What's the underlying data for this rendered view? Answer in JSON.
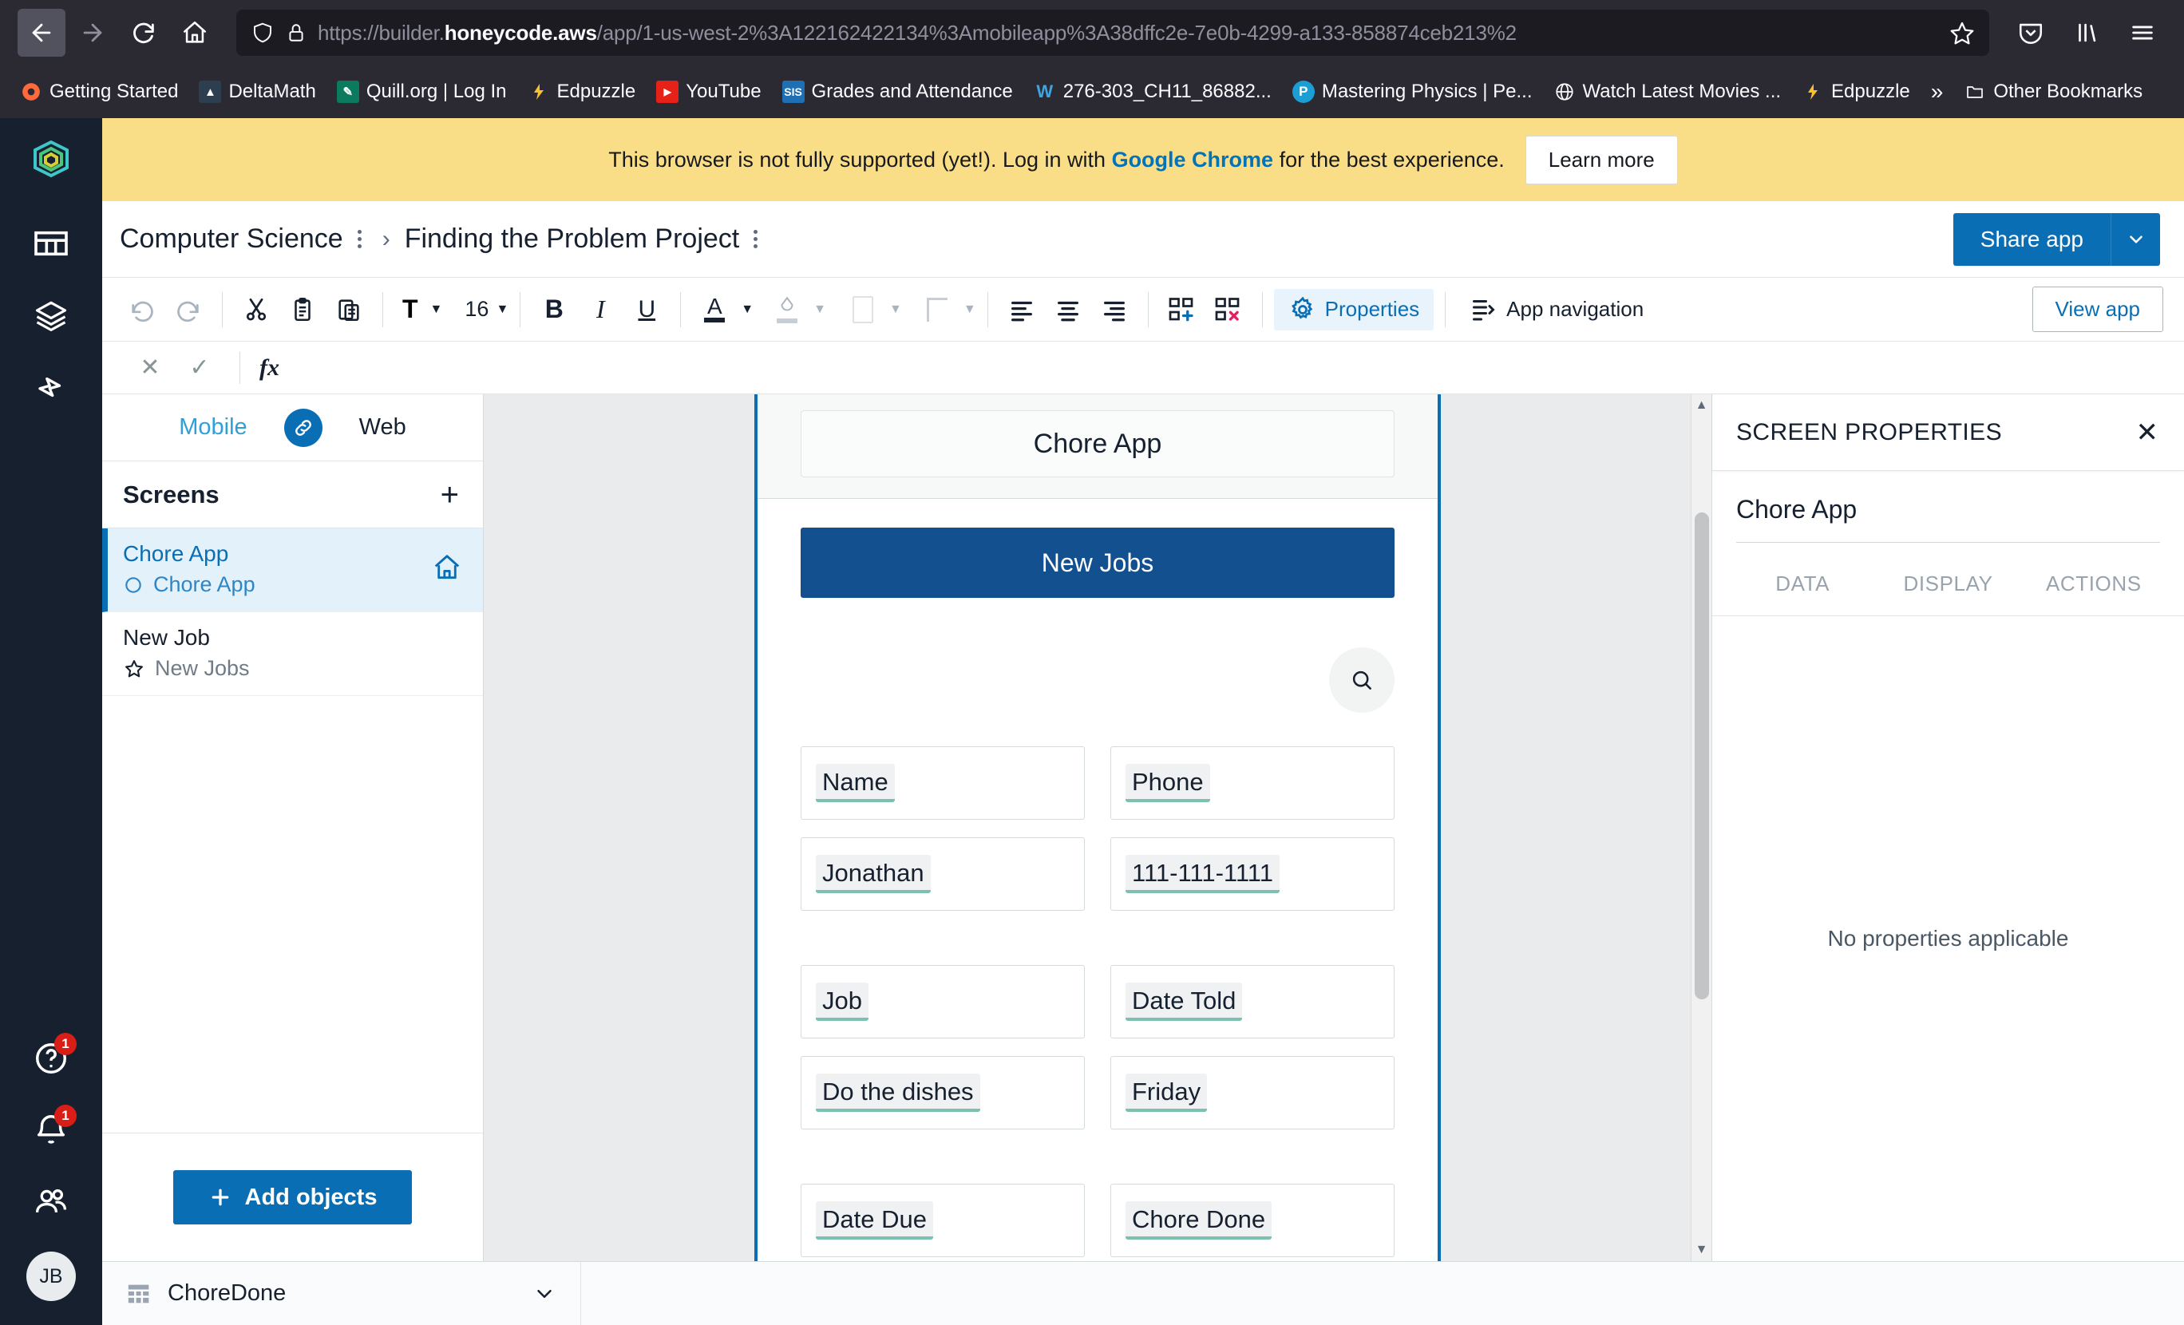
{
  "browser": {
    "url_prefix": "https://builder.",
    "url_bold": "honeycode.aws",
    "url_suffix": "/app/1-us-west-2%3A122162422134%3Amobileapp%3A38dffc2e-7e0b-4299-a133-858874ceb213%2",
    "nav": {
      "back": "back-arrow",
      "forward": "forward-arrow",
      "reload": "reload",
      "home": "home"
    },
    "bookmarks": [
      {
        "label": "Getting Started",
        "icon": "firefox-logo",
        "icon_text": "",
        "bg": "transparent"
      },
      {
        "label": "DeltaMath",
        "icon": "deltamath-logo",
        "icon_text": "▲",
        "bg": "#2c3e50"
      },
      {
        "label": "Quill.org | Log In",
        "icon": "quill-logo",
        "icon_text": "✎",
        "bg": "#0c7a5e"
      },
      {
        "label": "Edpuzzle",
        "icon": "edpuzzle-logo",
        "icon_text": "",
        "bg": "transparent"
      },
      {
        "label": "YouTube",
        "icon": "youtube-logo",
        "icon_text": "▶",
        "bg": "#e62117"
      },
      {
        "label": "Grades and Attendance",
        "icon": "sis-logo",
        "icon_text": "SIS",
        "bg": "#1f6fb5"
      },
      {
        "label": "276-303_CH11_86882...",
        "icon": "w-logo",
        "icon_text": "W",
        "bg": "transparent"
      },
      {
        "label": "Mastering Physics | Pe...",
        "icon": "pearson-logo",
        "icon_text": "P",
        "bg": "#1a9ed4"
      },
      {
        "label": "Watch Latest Movies ...",
        "icon": "globe-icon",
        "icon_text": "",
        "bg": "transparent"
      },
      {
        "label": "Edpuzzle",
        "icon": "edpuzzle-logo",
        "icon_text": "",
        "bg": "transparent"
      }
    ],
    "overflow_label": "»",
    "other_bookmarks": "Other Bookmarks"
  },
  "banner": {
    "text_before": "This browser is not fully supported (yet!). Log in with ",
    "link": "Google Chrome",
    "text_after": " for the best experience.",
    "button": "Learn more"
  },
  "header": {
    "breadcrumb_1": "Computer Science",
    "breadcrumb_2": "Finding the Problem Project",
    "separator": "›",
    "share_label": "Share app"
  },
  "toolbar": {
    "font_style": "T",
    "font_size": "16",
    "bold": "B",
    "italic": "I",
    "underline": "U",
    "text_color": "A",
    "properties_label": "Properties",
    "app_navigation_label": "App navigation",
    "view_app_label": "View app"
  },
  "formula_bar": {
    "cancel": "✕",
    "confirm": "✓",
    "fx": "fx",
    "value": ""
  },
  "sidebar": {
    "toggle_mobile": "Mobile",
    "toggle_web": "Web",
    "screens_title": "Screens",
    "add_screen": "+",
    "screens": [
      {
        "title": "Chore App",
        "subtitle": "Chore App",
        "icon": "circle-icon",
        "right_icon": "home-icon",
        "selected": true
      },
      {
        "title": "New Job",
        "subtitle": "New Jobs",
        "icon": "star-icon",
        "right_icon": "",
        "selected": false
      }
    ],
    "add_objects_label": "Add objects"
  },
  "canvas": {
    "app_title": "Chore App",
    "primary_button": "New Jobs",
    "search_icon": "search-icon",
    "fields": [
      {
        "label": "Name"
      },
      {
        "label": "Phone"
      },
      {
        "label": "Jonathan"
      },
      {
        "label": "111-111-1111"
      },
      {
        "label": "Job"
      },
      {
        "label": "Date Told"
      },
      {
        "label": "Do the dishes"
      },
      {
        "label": "Friday"
      },
      {
        "label": "Date Due"
      },
      {
        "label": "Chore Done"
      }
    ]
  },
  "properties": {
    "title": "SCREEN PROPERTIES",
    "close": "✕",
    "name": "Chore App",
    "tabs": [
      "DATA",
      "DISPLAY",
      "ACTIONS"
    ],
    "empty_message": "No properties applicable"
  },
  "bottom": {
    "table_name": "ChoreDone",
    "caret": "⌄"
  },
  "colors": {
    "accent_blue": "#0a6eb4",
    "deep_blue": "#12508f",
    "banner_yellow": "#fade87",
    "rail_dark": "#16202f",
    "token_underline": "#7cc0b0",
    "badge_red": "#d91e18"
  },
  "rail": {
    "badges": {
      "help": "1",
      "bell": "1"
    },
    "avatar": "JB"
  }
}
